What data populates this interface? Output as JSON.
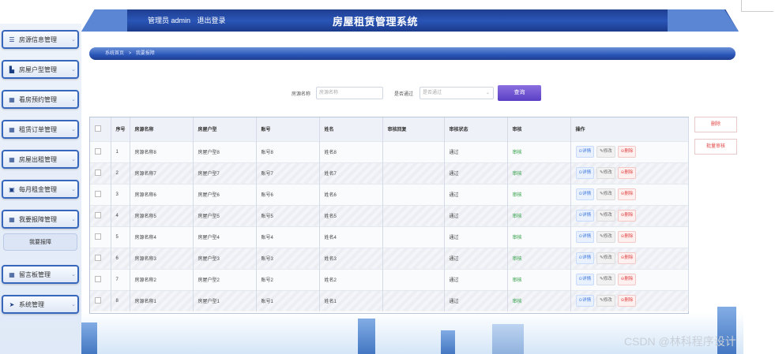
{
  "header": {
    "user_label": "管理员 admin",
    "logout_label": "退出登录",
    "title": "房屋租赁管理系统"
  },
  "sidebar": {
    "items": [
      {
        "label": "房源信息管理",
        "icon": "filter-icon"
      },
      {
        "label": "房屋户型管理",
        "icon": "building-icon"
      },
      {
        "label": "看房预约管理",
        "icon": "grid-icon"
      },
      {
        "label": "租赁订单管理",
        "icon": "grid-icon"
      },
      {
        "label": "房屋出租管理",
        "icon": "grid-icon"
      },
      {
        "label": "每月租金管理",
        "icon": "calendar-icon"
      },
      {
        "label": "我要报障管理",
        "icon": "grid-icon"
      },
      {
        "label": "留言板管理",
        "icon": "grid-icon"
      },
      {
        "label": "系统管理",
        "icon": "send-icon"
      }
    ],
    "active_sub": "我要报障"
  },
  "breadcrumb": {
    "home": "系统首页",
    "sep": ">",
    "current": "我要报障"
  },
  "search": {
    "name_label": "房源名称",
    "name_placeholder": "房源名称",
    "pass_label": "是否通过",
    "pass_placeholder": "是否通过",
    "button": "查询"
  },
  "table": {
    "columns": [
      "",
      "序号",
      "房源名称",
      "房屋户型",
      "账号",
      "姓名",
      "审核回复",
      "审核状态",
      "审核",
      "操作"
    ],
    "rows": [
      {
        "no": "1",
        "name": "房源名称8",
        "type": "房屋户型8",
        "account": "账号8",
        "person": "姓名8",
        "reply": "",
        "status": "通过",
        "audit": "审核"
      },
      {
        "no": "2",
        "name": "房源名称7",
        "type": "房屋户型7",
        "account": "账号7",
        "person": "姓名7",
        "reply": "",
        "status": "通过",
        "audit": "审核"
      },
      {
        "no": "3",
        "name": "房源名称6",
        "type": "房屋户型6",
        "account": "账号6",
        "person": "姓名6",
        "reply": "",
        "status": "通过",
        "audit": "审核"
      },
      {
        "no": "4",
        "name": "房源名称5",
        "type": "房屋户型5",
        "account": "账号5",
        "person": "姓名5",
        "reply": "",
        "status": "通过",
        "audit": "审核"
      },
      {
        "no": "5",
        "name": "房源名称4",
        "type": "房屋户型4",
        "account": "账号4",
        "person": "姓名4",
        "reply": "",
        "status": "通过",
        "audit": "审核"
      },
      {
        "no": "6",
        "name": "房源名称3",
        "type": "房屋户型3",
        "account": "账号3",
        "person": "姓名3",
        "reply": "",
        "status": "通过",
        "audit": "审核"
      },
      {
        "no": "7",
        "name": "房源名称2",
        "type": "房屋户型2",
        "account": "账号2",
        "person": "姓名2",
        "reply": "",
        "status": "通过",
        "audit": "审核"
      },
      {
        "no": "8",
        "name": "房源名称1",
        "type": "房屋户型1",
        "account": "账号1",
        "person": "姓名1",
        "reply": "",
        "status": "通过",
        "audit": "审核"
      }
    ],
    "actions": {
      "detail": "⊙详情",
      "edit": "✎修改",
      "delete": "⊝删除"
    }
  },
  "right_buttons": {
    "delete": "删除",
    "batch_audit": "批量审核"
  },
  "watermark": "CSDN @林科程序设计",
  "colors": {
    "accent": "#2a56b8",
    "pass_green": "#2f9e44",
    "danger": "#e04444"
  }
}
